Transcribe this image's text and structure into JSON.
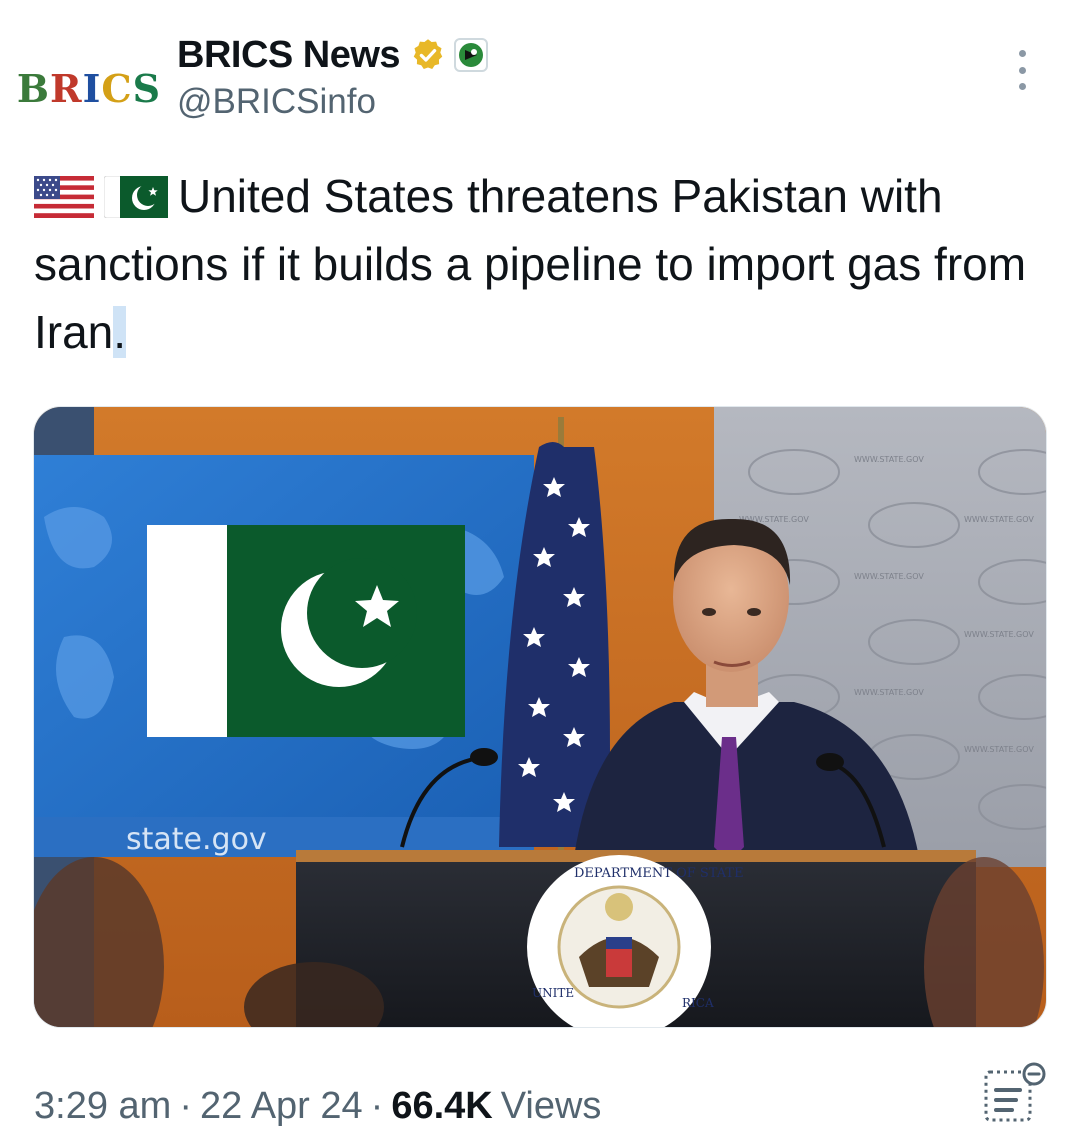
{
  "tweet": {
    "avatar_text": "BRICS",
    "display_name": "BRICS News",
    "handle": "@BRICSinfo",
    "text": "United States threatens Pakistan with sanctions if it builds a pipeline to import gas from Iran",
    "text_end": ".",
    "flags": [
      "us-flag-icon",
      "pakistan-flag-icon"
    ],
    "media": {
      "screen_text": "state.gov",
      "backdrop_text": "WWW.STATE.GOV",
      "seal_text_top": "DEPARTMENT OF STATE",
      "seal_text_left": "UNITE",
      "seal_text_right": "RICA"
    },
    "time": "3:29 am",
    "date": "22 Apr 24",
    "separator": "·",
    "views_count": "66.4K",
    "views_label": "Views"
  },
  "colors": {
    "verified_gold": "#e8b828",
    "secondary_text": "#536471",
    "primary_text": "#0f1419"
  },
  "icons": {
    "verified": "verified-badge-icon",
    "affiliation": "affiliate-badge-icon",
    "more": "more-options-icon",
    "analytics": "analytics-icon"
  }
}
